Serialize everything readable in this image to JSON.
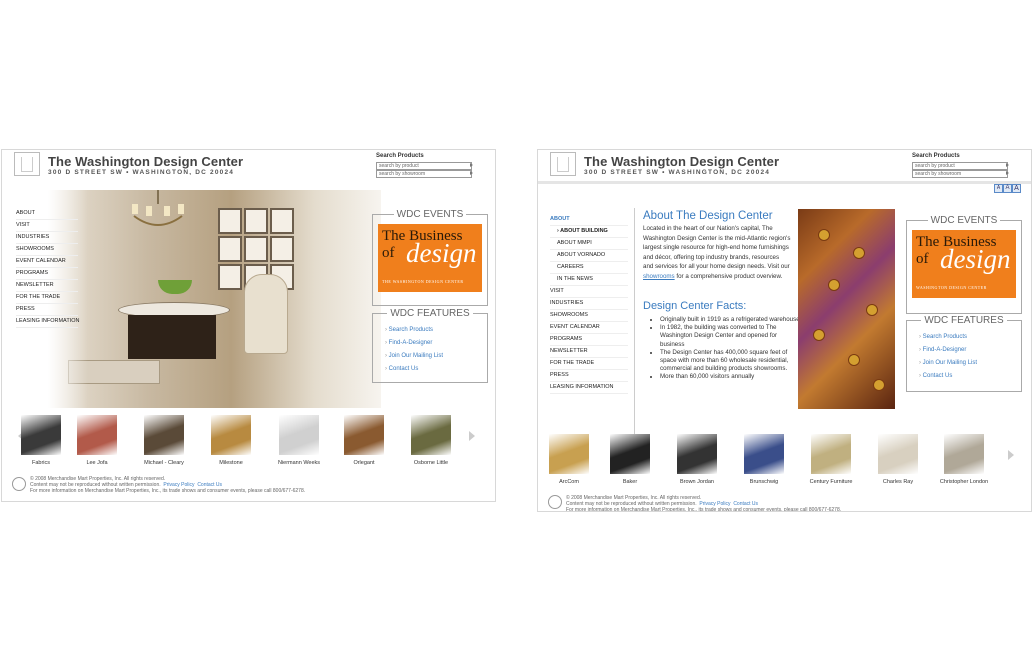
{
  "site": {
    "title": "The Washington Design Center",
    "address": "300 D STREET SW  •  WASHINGTON, DC 20024"
  },
  "search": {
    "label": "Search Products",
    "product_placeholder": "search by product",
    "showroom_placeholder": "search by showroom"
  },
  "home": {
    "nav": [
      "ABOUT",
      "VISIT",
      "INDUSTRIES",
      "SHOWROOMS",
      "EVENT CALENDAR",
      "PROGRAMS",
      "NEWSLETTER",
      "FOR THE TRADE",
      "PRESS",
      "LEASING INFORMATION"
    ],
    "thumbs": [
      "Fabrics",
      "Lee Jofa",
      "Michael - Cleary",
      "Milestone",
      "Niermann Weeks",
      "Orlegant",
      "Osborne Little"
    ],
    "thumb_colors": [
      "#3a3a3a",
      "#b25a4a",
      "#5a4a38",
      "#b88a40",
      "#d0d0d0",
      "#8a5a30",
      "#6a6a40"
    ]
  },
  "sidebar": {
    "events_title": "WDC EVENTS",
    "ad_line1": "The Business",
    "ad_line2": "of",
    "ad_script": "design",
    "ad_sub": "THE WASHINGTON DESIGN CENTER",
    "ad_sub2": "WASHINGTON DESIGN CENTER",
    "features_title": "WDC FEATURES",
    "features": [
      "Search Products",
      "Find-A-Designer",
      "Join Our Mailing List",
      "Contact Us"
    ]
  },
  "about": {
    "nav": [
      "ABOUT",
      "ABOUT BUILDING",
      "ABOUT MMPI",
      "ABOUT VORNADO",
      "CAREERS",
      "IN THE NEWS",
      "VISIT",
      "INDUSTRIES",
      "SHOWROOMS",
      "EVENT CALENDAR",
      "PROGRAMS",
      "NEWSLETTER",
      "FOR THE TRADE",
      "PRESS",
      "LEASING INFORMATION"
    ],
    "heading": "About The Design Center",
    "para_a": "Located in the heart of our Nation's capital, The Washington Design Center is the mid-Atlantic region's largest single resource for high-end home furnishings and décor, offering top industry brands, resources and services for all your home design needs. Visit our",
    "para_link": "showrooms",
    "para_b": "for a comprehensive product overview.",
    "facts_heading": "Design Center Facts:",
    "facts": [
      "Originally built in 1919 as a refrigerated warehouse",
      "In 1982, the building was converted to The Washington Design Center and opened for business",
      "The Design Center has 400,000 square feet of space with more than 60 wholesale residential, commercial and building products showrooms.",
      "More than 60,000 visitors annually"
    ],
    "size_buttons": [
      "A",
      "A",
      "A"
    ],
    "thumbs": [
      "ArcCom",
      "Baker",
      "Brown Jordan",
      "Brunschwig",
      "Century Furniture",
      "Charles Ray",
      "Christopher London"
    ],
    "thumb_colors": [
      "#c8a050",
      "#222222",
      "#333333",
      "#3a4e8a",
      "#c0b080",
      "#d8d0c0",
      "#b0a898"
    ]
  },
  "footer": {
    "copyright": "© 2008 Merchandise Mart Properties, Inc. All rights reserved.",
    "line2": "Content may not be reproduced without written permission.",
    "privacy": "Privacy Policy",
    "contact": "Contact Us",
    "line3": "For more information on Merchandise Mart Properties, Inc., its trade shows and consumer events, please call 800/677-6278."
  }
}
